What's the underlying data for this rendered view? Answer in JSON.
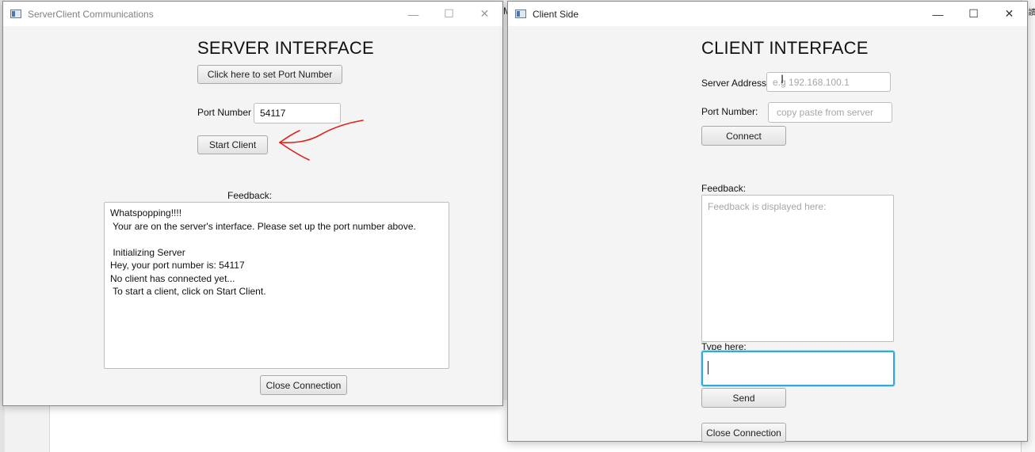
{
  "server_window": {
    "title": "ServerClient Communications",
    "heading": "SERVER INTERFACE",
    "set_port_button": "Click here to set Port Number",
    "port_label": "Port Number",
    "port_value": "54117",
    "start_client_button": "Start Client",
    "feedback_label": "Feedback:",
    "feedback_lines": [
      "Whatspopping!!!!",
      " Your are on the server's interface. Please set up the port number above.",
      "",
      " Initializing Server",
      "Hey, your port number is: 54117",
      "No client has connected yet...",
      " To start a client, click on Start Client."
    ],
    "close_connection_button": "Close Connection"
  },
  "client_window": {
    "title": "Client Side",
    "heading": "CLIENT INTERFACE",
    "server_address_label": "Server Address:",
    "server_address_placeholder": "e.g 192.168.100.1",
    "port_label": "Port Number:",
    "port_placeholder": "copy paste from server",
    "connect_button": "Connect",
    "feedback_label": "Feedback:",
    "feedback_placeholder": "Feedback is displayed here:",
    "type_here_label": "Type here:",
    "message_value": "",
    "send_button": "Send",
    "close_connection_button": "Close Connection"
  },
  "window_controls": {
    "minimize": "—",
    "maximize": "☐",
    "close": "✕"
  },
  "background": {
    "partial_letter": "M"
  },
  "colors": {
    "focus_ring": "#35a8d8",
    "annotation": "#e0201b"
  }
}
